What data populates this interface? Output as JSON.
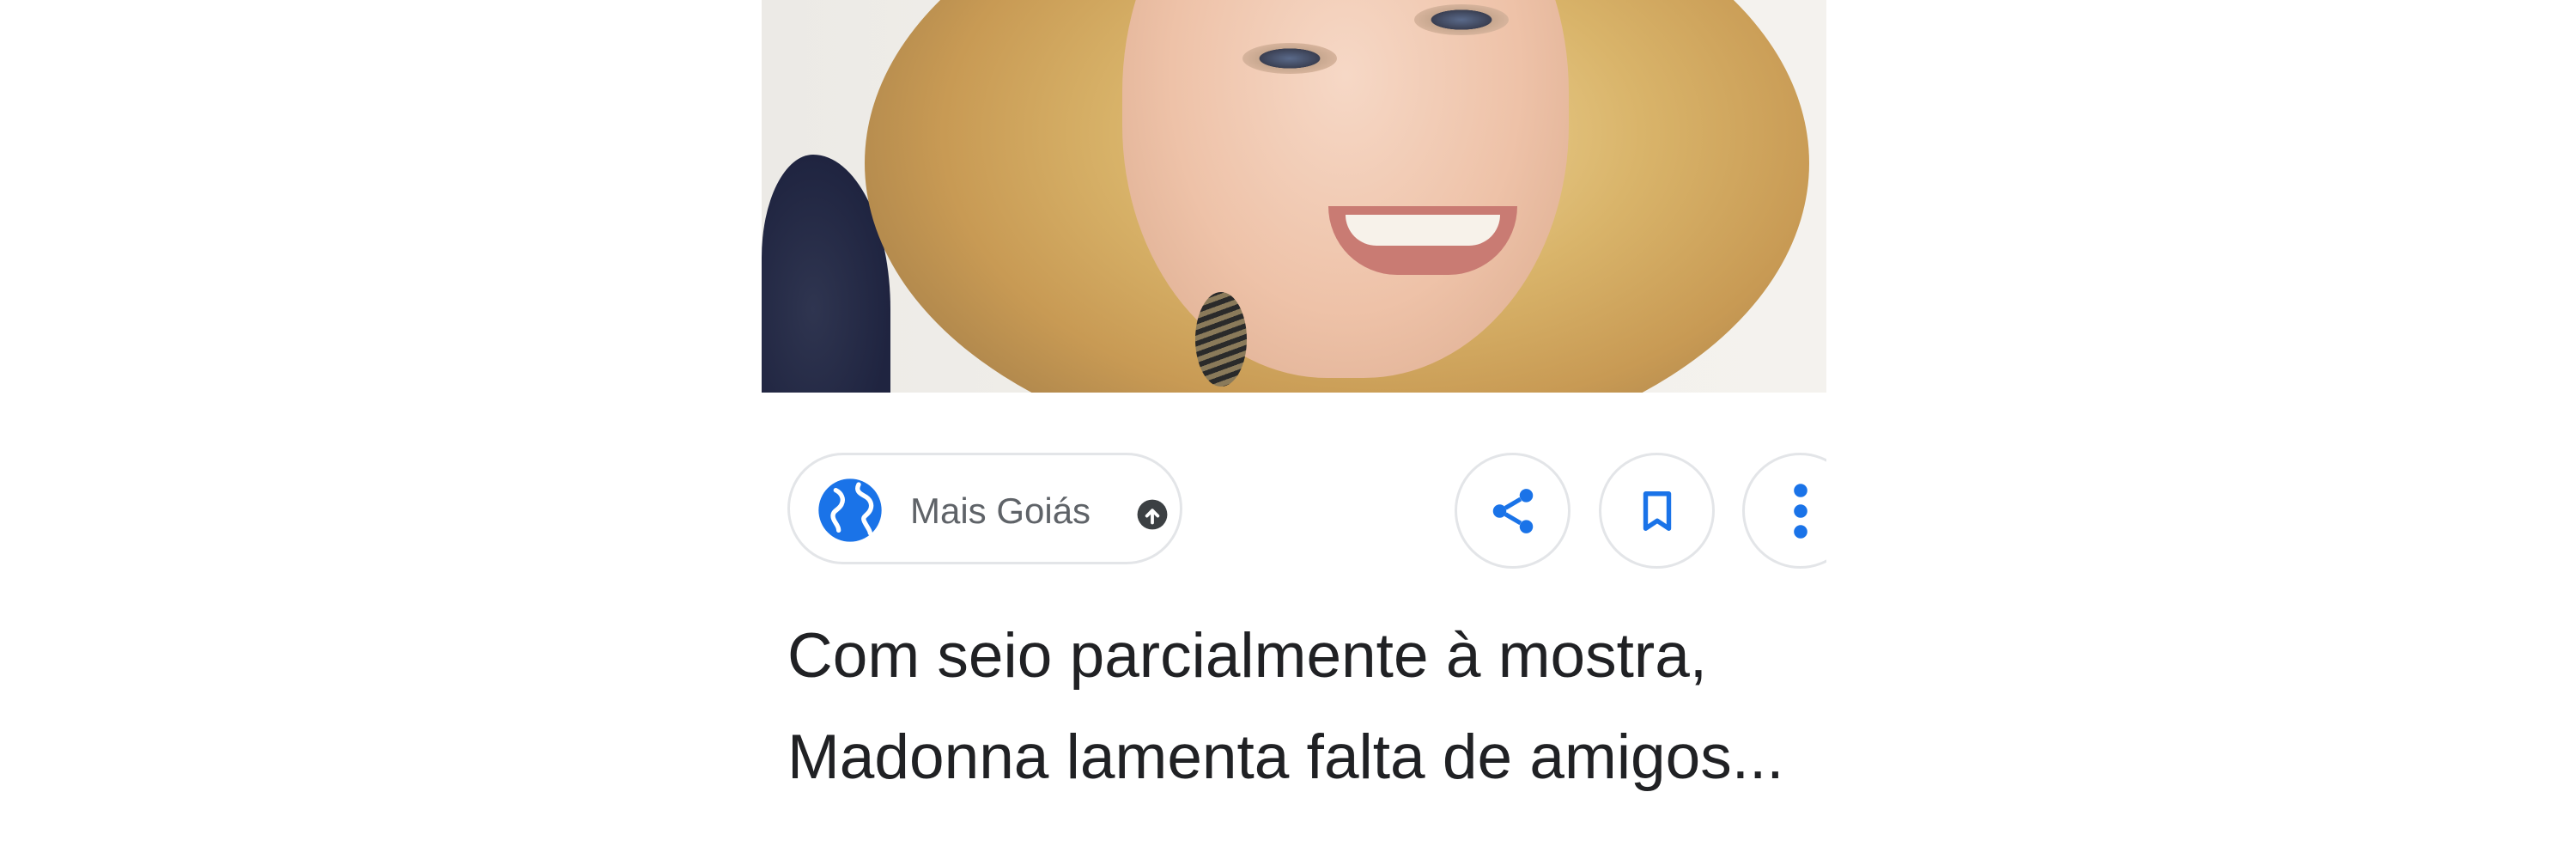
{
  "card": {
    "source": {
      "name": "Mais Goiás",
      "icon": "globe-icon",
      "indicator_icon": "arrow-circle-icon"
    },
    "actions": [
      {
        "icon": "share-icon"
      },
      {
        "icon": "bookmark-icon"
      },
      {
        "icon": "more-vert-icon"
      }
    ],
    "headline_lines": [
      "Com seio parcialmente à mostra,",
      "Madonna lamenta falta de amigos..."
    ]
  },
  "colors": {
    "accent": "#1a73e8",
    "text": "#202124",
    "secondary_text": "#5f6368",
    "border": "#e3e5e8"
  }
}
